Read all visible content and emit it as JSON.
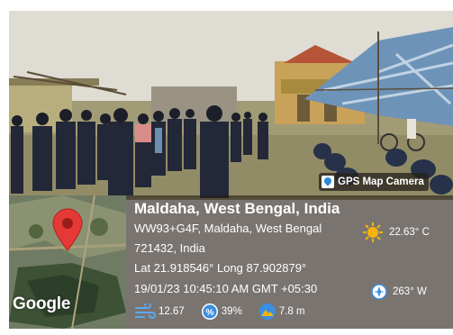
{
  "badge": {
    "label": "GPS Map Camera",
    "icon": "map-pin-icon"
  },
  "map": {
    "brand": "Google",
    "pin_color": "#e53935"
  },
  "location": {
    "title": "Maldaha, West Bengal, India",
    "address_line1": "WW93+G4F, Maldaha, West Bengal",
    "address_line2": "721432, India",
    "coordinates": "Lat 21.918546° Long 87.902879°",
    "datetime": "19/01/23 10:45:10 AM GMT +05:30"
  },
  "weather": {
    "temperature": "22.63° C",
    "temperature_icon": "sun-icon",
    "heading": "263° W",
    "heading_icon": "compass-icon",
    "wind": "12.67",
    "wind_icon": "wind-icon",
    "humidity": "39%",
    "humidity_icon": "humidity-icon",
    "altitude": "7.8 m",
    "altitude_icon": "altitude-icon"
  },
  "colors": {
    "overlay": "#261e18",
    "accent_blue": "#3a8fe0",
    "sun": "#f6b30b"
  }
}
